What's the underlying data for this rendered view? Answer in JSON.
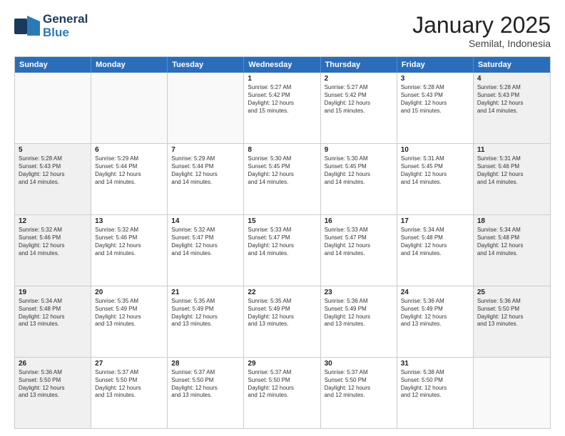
{
  "header": {
    "logo_line1": "General",
    "logo_line2": "Blue",
    "title": "January 2025",
    "subtitle": "Semilat, Indonesia"
  },
  "weekdays": [
    "Sunday",
    "Monday",
    "Tuesday",
    "Wednesday",
    "Thursday",
    "Friday",
    "Saturday"
  ],
  "rows": [
    [
      {
        "day": "",
        "text": ""
      },
      {
        "day": "",
        "text": ""
      },
      {
        "day": "",
        "text": ""
      },
      {
        "day": "1",
        "text": "Sunrise: 5:27 AM\nSunset: 5:42 PM\nDaylight: 12 hours\nand 15 minutes."
      },
      {
        "day": "2",
        "text": "Sunrise: 5:27 AM\nSunset: 5:42 PM\nDaylight: 12 hours\nand 15 minutes."
      },
      {
        "day": "3",
        "text": "Sunrise: 5:28 AM\nSunset: 5:43 PM\nDaylight: 12 hours\nand 15 minutes."
      },
      {
        "day": "4",
        "text": "Sunrise: 5:28 AM\nSunset: 5:43 PM\nDaylight: 12 hours\nand 14 minutes."
      }
    ],
    [
      {
        "day": "5",
        "text": "Sunrise: 5:28 AM\nSunset: 5:43 PM\nDaylight: 12 hours\nand 14 minutes."
      },
      {
        "day": "6",
        "text": "Sunrise: 5:29 AM\nSunset: 5:44 PM\nDaylight: 12 hours\nand 14 minutes."
      },
      {
        "day": "7",
        "text": "Sunrise: 5:29 AM\nSunset: 5:44 PM\nDaylight: 12 hours\nand 14 minutes."
      },
      {
        "day": "8",
        "text": "Sunrise: 5:30 AM\nSunset: 5:45 PM\nDaylight: 12 hours\nand 14 minutes."
      },
      {
        "day": "9",
        "text": "Sunrise: 5:30 AM\nSunset: 5:45 PM\nDaylight: 12 hours\nand 14 minutes."
      },
      {
        "day": "10",
        "text": "Sunrise: 5:31 AM\nSunset: 5:45 PM\nDaylight: 12 hours\nand 14 minutes."
      },
      {
        "day": "11",
        "text": "Sunrise: 5:31 AM\nSunset: 5:46 PM\nDaylight: 12 hours\nand 14 minutes."
      }
    ],
    [
      {
        "day": "12",
        "text": "Sunrise: 5:32 AM\nSunset: 5:46 PM\nDaylight: 12 hours\nand 14 minutes."
      },
      {
        "day": "13",
        "text": "Sunrise: 5:32 AM\nSunset: 5:46 PM\nDaylight: 12 hours\nand 14 minutes."
      },
      {
        "day": "14",
        "text": "Sunrise: 5:32 AM\nSunset: 5:47 PM\nDaylight: 12 hours\nand 14 minutes."
      },
      {
        "day": "15",
        "text": "Sunrise: 5:33 AM\nSunset: 5:47 PM\nDaylight: 12 hours\nand 14 minutes."
      },
      {
        "day": "16",
        "text": "Sunrise: 5:33 AM\nSunset: 5:47 PM\nDaylight: 12 hours\nand 14 minutes."
      },
      {
        "day": "17",
        "text": "Sunrise: 5:34 AM\nSunset: 5:48 PM\nDaylight: 12 hours\nand 14 minutes."
      },
      {
        "day": "18",
        "text": "Sunrise: 5:34 AM\nSunset: 5:48 PM\nDaylight: 12 hours\nand 14 minutes."
      }
    ],
    [
      {
        "day": "19",
        "text": "Sunrise: 5:34 AM\nSunset: 5:48 PM\nDaylight: 12 hours\nand 13 minutes."
      },
      {
        "day": "20",
        "text": "Sunrise: 5:35 AM\nSunset: 5:49 PM\nDaylight: 12 hours\nand 13 minutes."
      },
      {
        "day": "21",
        "text": "Sunrise: 5:35 AM\nSunset: 5:49 PM\nDaylight: 12 hours\nand 13 minutes."
      },
      {
        "day": "22",
        "text": "Sunrise: 5:35 AM\nSunset: 5:49 PM\nDaylight: 12 hours\nand 13 minutes."
      },
      {
        "day": "23",
        "text": "Sunrise: 5:36 AM\nSunset: 5:49 PM\nDaylight: 12 hours\nand 13 minutes."
      },
      {
        "day": "24",
        "text": "Sunrise: 5:36 AM\nSunset: 5:49 PM\nDaylight: 12 hours\nand 13 minutes."
      },
      {
        "day": "25",
        "text": "Sunrise: 5:36 AM\nSunset: 5:50 PM\nDaylight: 12 hours\nand 13 minutes."
      }
    ],
    [
      {
        "day": "26",
        "text": "Sunrise: 5:36 AM\nSunset: 5:50 PM\nDaylight: 12 hours\nand 13 minutes."
      },
      {
        "day": "27",
        "text": "Sunrise: 5:37 AM\nSunset: 5:50 PM\nDaylight: 12 hours\nand 13 minutes."
      },
      {
        "day": "28",
        "text": "Sunrise: 5:37 AM\nSunset: 5:50 PM\nDaylight: 12 hours\nand 13 minutes."
      },
      {
        "day": "29",
        "text": "Sunrise: 5:37 AM\nSunset: 5:50 PM\nDaylight: 12 hours\nand 12 minutes."
      },
      {
        "day": "30",
        "text": "Sunrise: 5:37 AM\nSunset: 5:50 PM\nDaylight: 12 hours\nand 12 minutes."
      },
      {
        "day": "31",
        "text": "Sunrise: 5:38 AM\nSunset: 5:50 PM\nDaylight: 12 hours\nand 12 minutes."
      },
      {
        "day": "",
        "text": ""
      }
    ]
  ]
}
